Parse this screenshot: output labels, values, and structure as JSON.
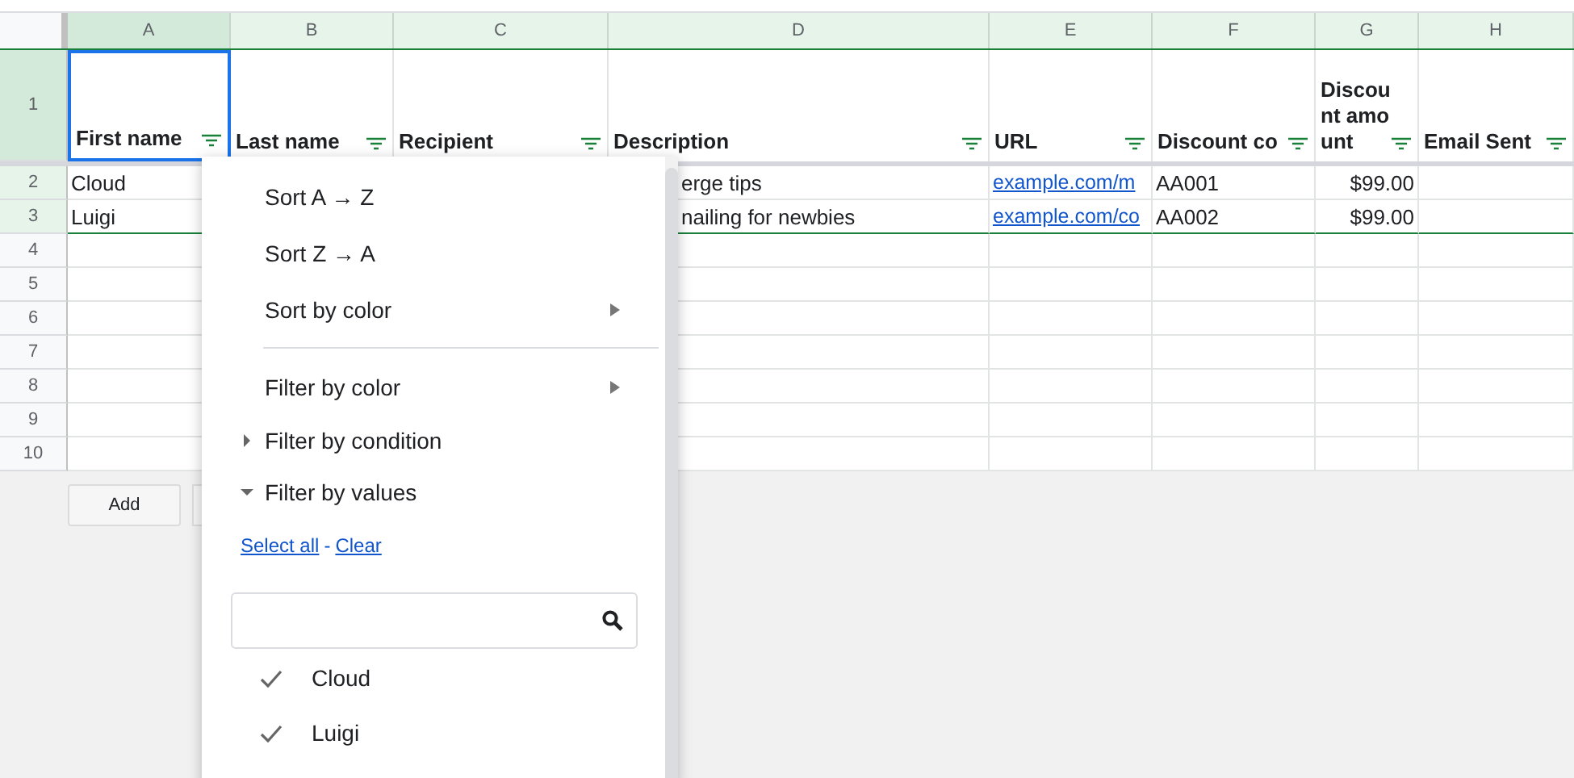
{
  "column_headers": [
    {
      "label": "A",
      "selected": true
    },
    {
      "label": "B",
      "selected": false
    },
    {
      "label": "C",
      "selected": false
    },
    {
      "label": "D",
      "selected": false
    },
    {
      "label": "E",
      "selected": false
    },
    {
      "label": "F",
      "selected": false
    },
    {
      "label": "G",
      "selected": false
    },
    {
      "label": "H",
      "selected": false
    }
  ],
  "row_headers": [
    {
      "label": "1",
      "selected": true
    },
    {
      "label": "2",
      "selected": false
    },
    {
      "label": "3",
      "selected": false
    },
    {
      "label": "4",
      "selected": false
    },
    {
      "label": "5",
      "selected": false
    },
    {
      "label": "6",
      "selected": false
    },
    {
      "label": "7",
      "selected": false
    },
    {
      "label": "8",
      "selected": false
    },
    {
      "label": "9",
      "selected": false
    },
    {
      "label": "10",
      "selected": false
    }
  ],
  "header_cells": [
    "First name",
    "Last name",
    "Recipient",
    "Description",
    "URL",
    "Discount co",
    "Discount amount",
    "Email Sent"
  ],
  "rows": [
    {
      "first_name": "Cloud",
      "description": "erge tips",
      "url": "example.com/m",
      "discount_code": "AA001",
      "discount_amount": "$99.00"
    },
    {
      "first_name": "Luigi",
      "description": "nailing for newbies",
      "url": "example.com/co",
      "discount_code": "AA002",
      "discount_amount": "$99.00"
    }
  ],
  "buttons": [
    "Add"
  ],
  "filter_menu": {
    "items": [
      {
        "kind": "action",
        "label": "Sort A → Z"
      },
      {
        "kind": "action",
        "label": "Sort Z → A"
      },
      {
        "kind": "submenu",
        "label": "Sort by color"
      },
      {
        "kind": "divider"
      },
      {
        "kind": "submenu",
        "label": "Filter by color"
      },
      {
        "kind": "section",
        "label": "Filter by condition",
        "expanded": false
      },
      {
        "kind": "section",
        "label": "Filter by values",
        "expanded": true
      }
    ],
    "select_all": "Select all",
    "separator": "-",
    "clear": "Clear",
    "values": [
      {
        "label": "Cloud",
        "checked": true
      },
      {
        "label": "Luigi",
        "checked": true
      }
    ]
  }
}
